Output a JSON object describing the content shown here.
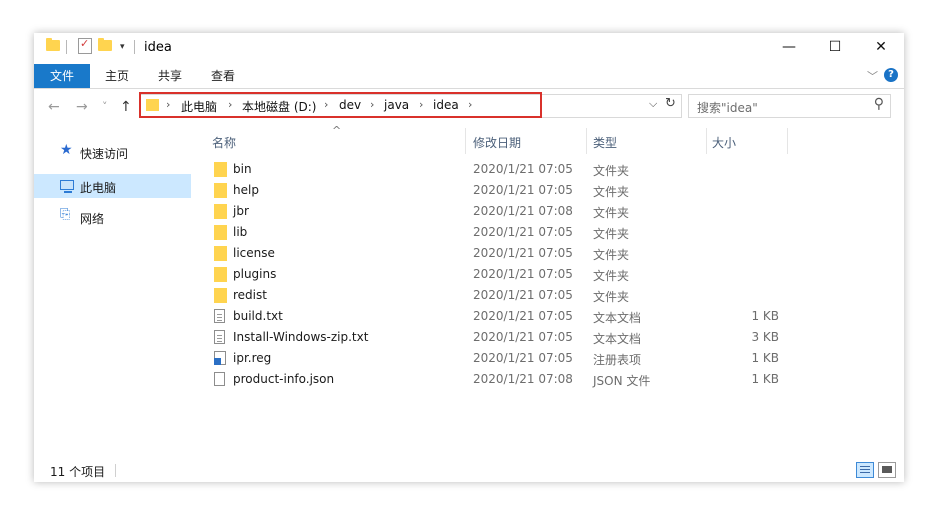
{
  "window": {
    "title": "idea",
    "minimize_glyph": "—",
    "maximize_glyph": "☐",
    "close_glyph": "✕",
    "quick_access_arrow": "▾"
  },
  "ribbon": {
    "file_tab": "文件",
    "tabs": [
      "主页",
      "共享",
      "查看"
    ],
    "expand_glyph": "﹀",
    "help_glyph": "?"
  },
  "nav": {
    "back_glyph": "←",
    "forward_glyph": "→",
    "recent_glyph": "˅",
    "up_glyph": "↑",
    "breadcrumbs": [
      "此电脑",
      "本地磁盘 (D:)",
      "dev",
      "java",
      "idea"
    ],
    "separator": "›",
    "dropdown_glyph": "⌵",
    "refresh_glyph": "↻"
  },
  "search": {
    "placeholder": "搜索\"idea\"",
    "icon": "magnifier"
  },
  "sidebar": {
    "items": [
      {
        "label": "快速访问",
        "icon": "star-icon",
        "glyph": "★",
        "selected": false
      },
      {
        "label": "此电脑",
        "icon": "computer-icon",
        "glyph": "",
        "selected": true
      },
      {
        "label": "网络",
        "icon": "network-icon",
        "glyph": "⎘",
        "selected": false
      }
    ]
  },
  "columns": {
    "name": "名称",
    "date": "修改日期",
    "type": "类型",
    "size": "大小",
    "sort_glyph": "^"
  },
  "files": [
    {
      "name": "bin",
      "date": "2020/1/21 07:05",
      "type": "文件夹",
      "size": "",
      "icon": "folder"
    },
    {
      "name": "help",
      "date": "2020/1/21 07:05",
      "type": "文件夹",
      "size": "",
      "icon": "folder"
    },
    {
      "name": "jbr",
      "date": "2020/1/21 07:08",
      "type": "文件夹",
      "size": "",
      "icon": "folder"
    },
    {
      "name": "lib",
      "date": "2020/1/21 07:05",
      "type": "文件夹",
      "size": "",
      "icon": "folder"
    },
    {
      "name": "license",
      "date": "2020/1/21 07:05",
      "type": "文件夹",
      "size": "",
      "icon": "folder"
    },
    {
      "name": "plugins",
      "date": "2020/1/21 07:05",
      "type": "文件夹",
      "size": "",
      "icon": "folder"
    },
    {
      "name": "redist",
      "date": "2020/1/21 07:05",
      "type": "文件夹",
      "size": "",
      "icon": "folder"
    },
    {
      "name": "build.txt",
      "date": "2020/1/21 07:05",
      "type": "文本文档",
      "size": "1 KB",
      "icon": "doc"
    },
    {
      "name": "Install-Windows-zip.txt",
      "date": "2020/1/21 07:05",
      "type": "文本文档",
      "size": "3 KB",
      "icon": "doc"
    },
    {
      "name": "ipr.reg",
      "date": "2020/1/21 07:05",
      "type": "注册表项",
      "size": "1 KB",
      "icon": "reg"
    },
    {
      "name": "product-info.json",
      "date": "2020/1/21 07:08",
      "type": "JSON 文件",
      "size": "1 KB",
      "icon": "json"
    }
  ],
  "status": {
    "item_count": "11 个项目"
  },
  "colors": {
    "accent": "#1979ca",
    "selection": "#cce8ff",
    "highlight_border": "#d9312b",
    "folder": "#ffd44f"
  }
}
